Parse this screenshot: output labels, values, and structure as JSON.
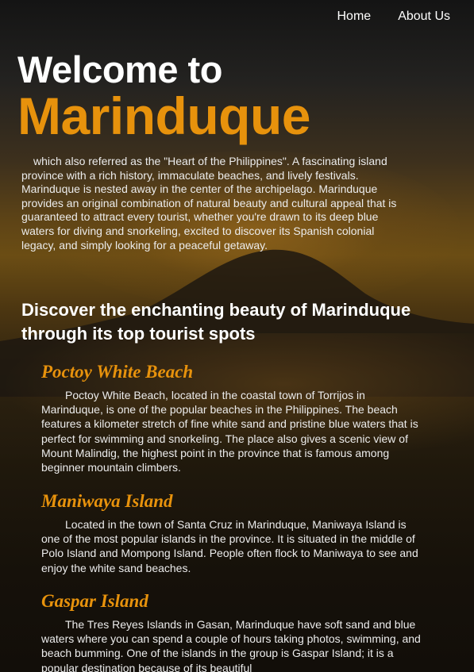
{
  "nav": {
    "items": [
      {
        "label": "Home"
      },
      {
        "label": "About Us"
      }
    ]
  },
  "hero": {
    "welcome": "Welcome to",
    "place": "Marinduque",
    "intro": "which also referred as the \"Heart of the Philippines\". A fascinating island province with a rich history, immaculate beaches, and lively festivals. Marinduque is nested away in the center of the archipelago. Marinduque provides an original combination of natural beauty and cultural appeal that is guaranteed to attract every tourist, whether you're drawn to its deep blue waters for diving and snorkeling, excited to discover its Spanish colonial legacy, and simply looking for a peaceful getaway."
  },
  "discover_heading": "Discover the enchanting beauty of Marinduque through its top tourist spots",
  "spots": [
    {
      "title": "Poctoy White Beach",
      "description": "Poctoy White Beach, located in the coastal town of Torrijos in Marinduque, is one of the popular beaches in the Philippines. The beach features a kilometer stretch of fine white sand and pristine blue waters that is perfect for swimming and snorkeling. The place also gives a scenic view of Mount Malindig, the highest point in the province that is famous among beginner mountain climbers."
    },
    {
      "title": "Maniwaya Island",
      "description": "Located in the town of Santa Cruz in Marinduque, Maniwaya Island is one of the most popular islands in the province. It is situated in the middle of Polo Island and Mompong Island. People often flock to Maniwaya to see and enjoy the white sand beaches."
    },
    {
      "title": "Gaspar Island",
      "description": "The Tres Reyes Islands in Gasan, Marinduque have soft sand and blue waters where you can spend a couple of hours taking photos, swimming, and beach bumming. One of the islands in the group is Gaspar Island; it is a popular destination because of its beautiful"
    }
  ],
  "colors": {
    "accent": "#e7920c",
    "text": "#ececec",
    "heading": "#ffffff"
  }
}
